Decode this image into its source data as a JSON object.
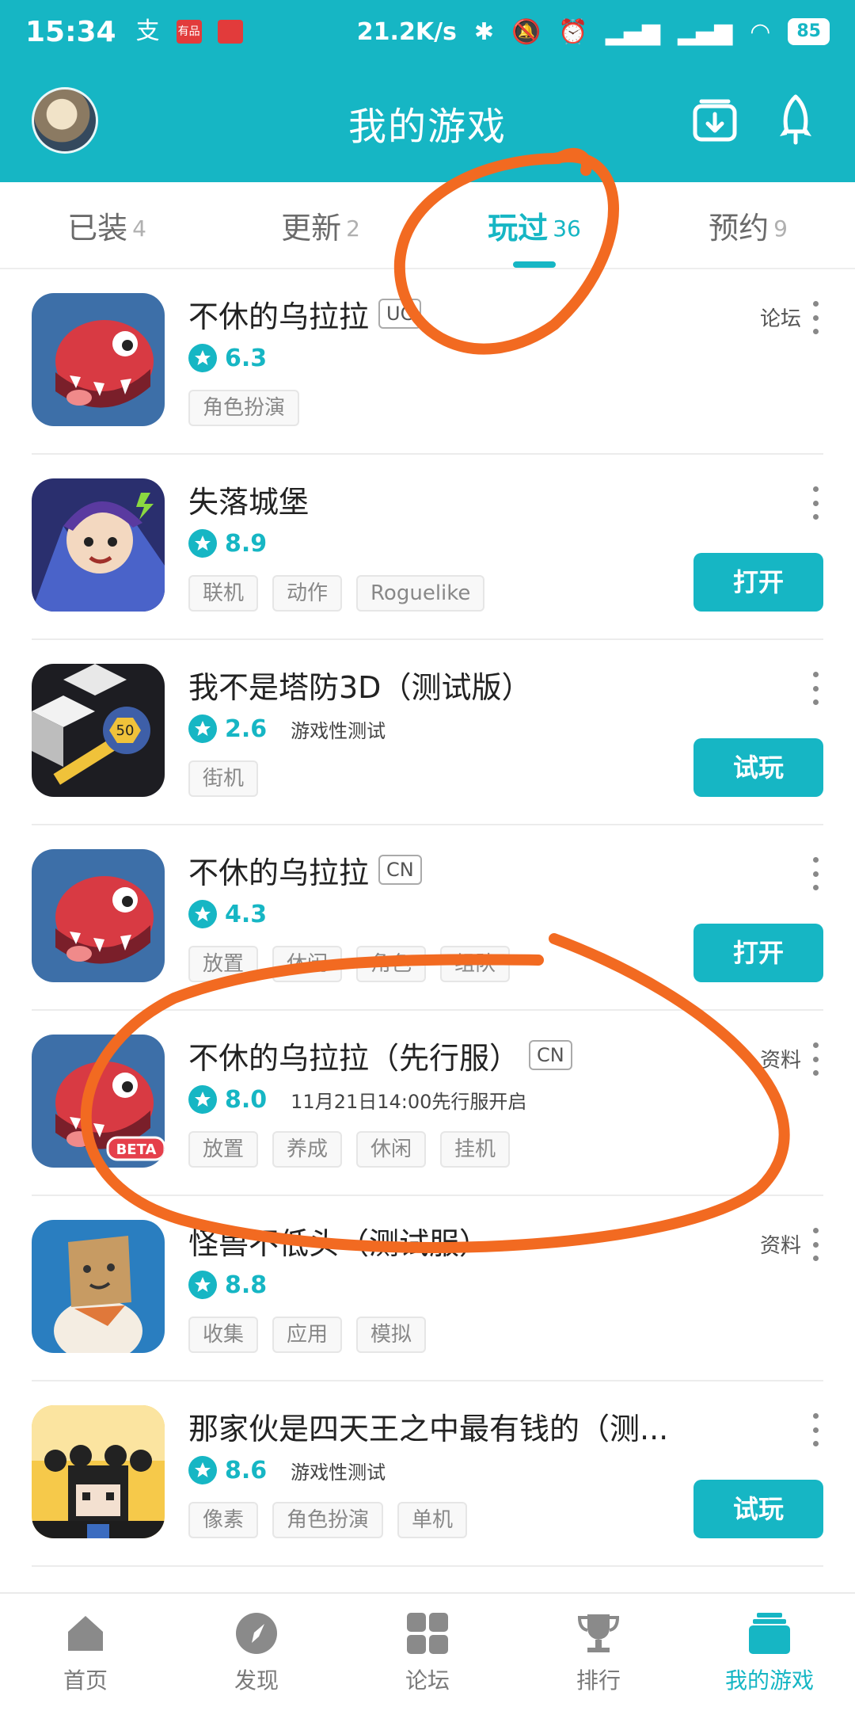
{
  "status_bar": {
    "time": "15:34",
    "notif_alipay": "支",
    "notif_youpin": "有品",
    "network_speed": "21.2K/s",
    "battery": "85"
  },
  "header": {
    "title": "我的游戏"
  },
  "tabs": [
    {
      "label": "已装",
      "count": "4"
    },
    {
      "label": "更新",
      "count": "2"
    },
    {
      "label": "玩过",
      "count": "36",
      "active": true
    },
    {
      "label": "预约",
      "count": "9"
    }
  ],
  "games": [
    {
      "title": "不休的乌拉拉",
      "badge": "UC",
      "rating": "6.3",
      "note": "",
      "tags": [
        "角色扮演"
      ],
      "side_link": "论坛",
      "action": ""
    },
    {
      "title": "失落城堡",
      "badge": "",
      "rating": "8.9",
      "note": "",
      "tags": [
        "联机",
        "动作",
        "Roguelike"
      ],
      "side_link": "",
      "action": "打开"
    },
    {
      "title": "我不是塔防3D（测试版）",
      "badge": "",
      "rating": "2.6",
      "note": "游戏性测试",
      "tags": [
        "街机"
      ],
      "side_link": "",
      "action": "试玩"
    },
    {
      "title": "不休的乌拉拉",
      "badge": "CN",
      "rating": "4.3",
      "note": "",
      "tags": [
        "放置",
        "休闲",
        "角色",
        "组队"
      ],
      "side_link": "",
      "action": "打开"
    },
    {
      "title": "不休的乌拉拉（先行服）",
      "badge": "CN",
      "rating": "8.0",
      "note": "11月21日14:00先行服开启",
      "tags": [
        "放置",
        "养成",
        "休闲",
        "挂机"
      ],
      "side_link": "资料",
      "action": ""
    },
    {
      "title": "怪兽不低头（测试服）",
      "badge": "",
      "rating": "8.8",
      "note": "",
      "tags": [
        "收集",
        "应用",
        "模拟"
      ],
      "side_link": "资料",
      "action": ""
    },
    {
      "title": "那家伙是四天王之中最有钱的（测...",
      "badge": "",
      "rating": "8.6",
      "note": "游戏性测试",
      "tags": [
        "像素",
        "角色扮演",
        "单机"
      ],
      "side_link": "",
      "action": "试玩"
    }
  ],
  "bottom_nav": [
    {
      "label": "首页",
      "icon": "home-icon"
    },
    {
      "label": "发现",
      "icon": "compass-icon"
    },
    {
      "label": "论坛",
      "icon": "grid-icon"
    },
    {
      "label": "排行",
      "icon": "trophy-icon"
    },
    {
      "label": "我的游戏",
      "icon": "stack-icon",
      "active": true
    }
  ],
  "colors": {
    "accent": "#16b6c4",
    "annotation": "#f26a21"
  }
}
